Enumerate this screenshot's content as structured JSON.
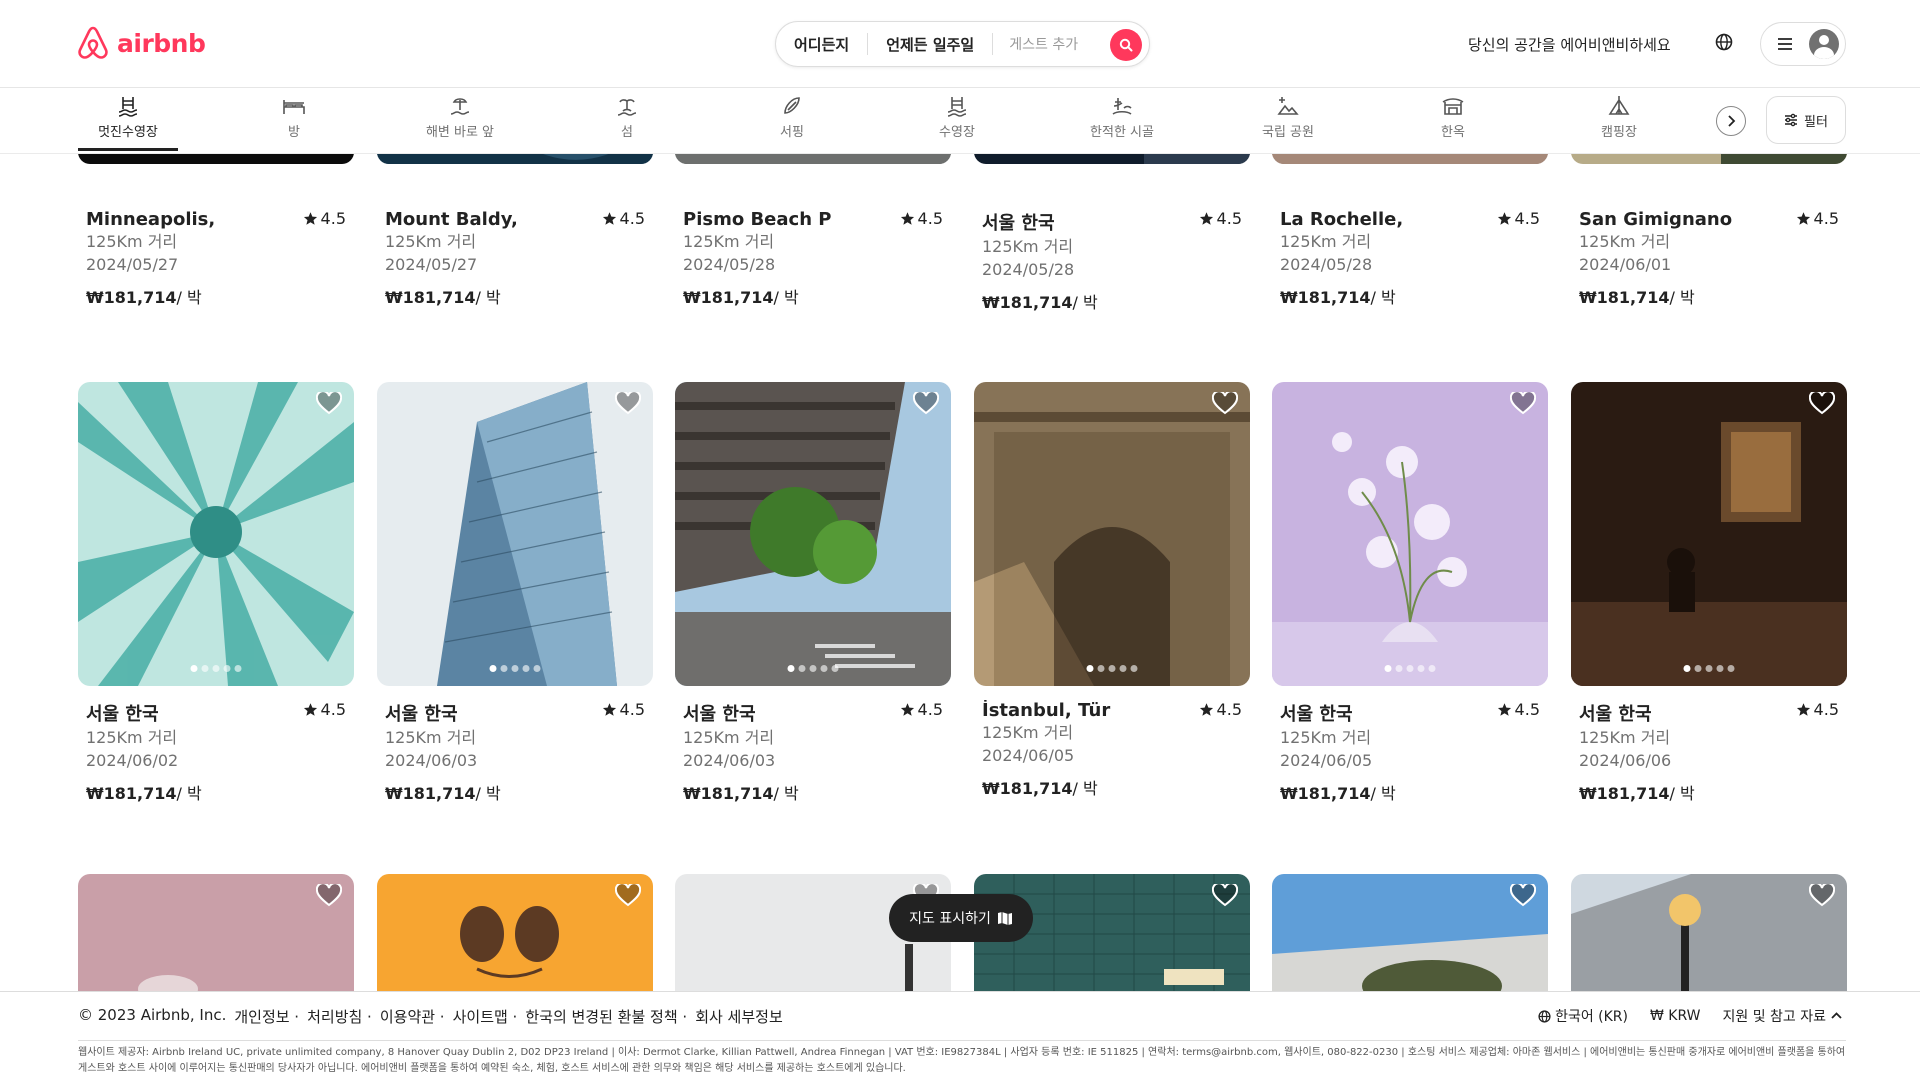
{
  "header": {
    "logo_text": "airbnb",
    "search": {
      "where": "어디든지",
      "when": "언제든 일주일",
      "guests": "게스트 추가"
    },
    "host_link": "당신의 공간을 에어비앤비하세요"
  },
  "categories": [
    {
      "label": "멋진수영장",
      "icon": "pool-icon"
    },
    {
      "label": "방",
      "icon": "bed-icon"
    },
    {
      "label": "해변 바로 앞",
      "icon": "beachfront-icon"
    },
    {
      "label": "섬",
      "icon": "island-icon"
    },
    {
      "label": "서핑",
      "icon": "surfboard-icon"
    },
    {
      "label": "수영장",
      "icon": "pool-icon"
    },
    {
      "label": "한적한 시골",
      "icon": "countryside-icon"
    },
    {
      "label": "국립 공원",
      "icon": "national-park-icon"
    },
    {
      "label": "한옥",
      "icon": "hanok-icon"
    },
    {
      "label": "캠핑장",
      "icon": "camping-icon"
    }
  ],
  "filter_label": "필터",
  "price_text": "₩181,714",
  "price_unit": "/ 박",
  "rows": [
    [
      {
        "title": "Minneapolis,",
        "rating": "4.5",
        "distance": "125Km 거리",
        "date": "2024/05/27"
      },
      {
        "title": "Mount Baldy,",
        "rating": "4.5",
        "distance": "125Km 거리",
        "date": "2024/05/27"
      },
      {
        "title": "Pismo Beach P",
        "rating": "4.5",
        "distance": "125Km 거리",
        "date": "2024/05/28"
      },
      {
        "title": "서울 한국",
        "rating": "4.5",
        "distance": "125Km 거리",
        "date": "2024/05/28"
      },
      {
        "title": "La Rochelle,",
        "rating": "4.5",
        "distance": "125Km 거리",
        "date": "2024/05/28"
      },
      {
        "title": "San Gimignano",
        "rating": "4.5",
        "distance": "125Km 거리",
        "date": "2024/06/01"
      }
    ],
    [
      {
        "title": "서울 한국",
        "rating": "4.5",
        "distance": "125Km 거리",
        "date": "2024/06/02"
      },
      {
        "title": "서울 한국",
        "rating": "4.5",
        "distance": "125Km 거리",
        "date": "2024/06/03"
      },
      {
        "title": "서울 한국",
        "rating": "4.5",
        "distance": "125Km 거리",
        "date": "2024/06/03"
      },
      {
        "title": "İstanbul, Tür",
        "rating": "4.5",
        "distance": "125Km 거리",
        "date": "2024/06/05"
      },
      {
        "title": "서울 한국",
        "rating": "4.5",
        "distance": "125Km 거리",
        "date": "2024/06/05"
      },
      {
        "title": "서울 한국",
        "rating": "4.5",
        "distance": "125Km 거리",
        "date": "2024/06/06"
      }
    ]
  ],
  "map_button": "지도 표시하기",
  "footer": {
    "links": [
      "© 2023 Airbnb, Inc.",
      "개인정보 ·",
      "처리방침 ·",
      "이용약관 ·",
      "사이트맵 ·",
      "한국의 변경된 환불 정책 ·",
      "회사 세부정보"
    ],
    "language": "한국어 (KR)",
    "currency": "₩ KRW",
    "support": "지원 및 참고 자료",
    "legal": "웹사이트 제공자: Airbnb Ireland UC, private unlimited company, 8 Hanover Quay Dublin 2, D02 DP23 Ireland | 이사: Dermot Clarke, Killian Pattwell, Andrea Finnegan | VAT 번호: IE9827384L | 사업자 등록 번호: IE 511825 | 연락처: terms@airbnb.com, 웹사이트, 080-822-0230 | 호스팅 서비스 제공업체: 아마존 웹서비스 | 에어비앤비는 통신판매 중개자로 에어비앤비 플랫폼을 통하여 게스트와 호스트 사이에 이루어지는 통신판매의 당사자가 아닙니다. 에어비앤비 플랫폼을 통하여 예약된 숙소, 체험, 호스트 서비스에 관한 의무와 책임은 해당 서비스를 제공하는 호스트에게 있습니다."
  },
  "colors": {
    "brand": "#ff385c",
    "text": "#222222",
    "muted": "#717171"
  }
}
